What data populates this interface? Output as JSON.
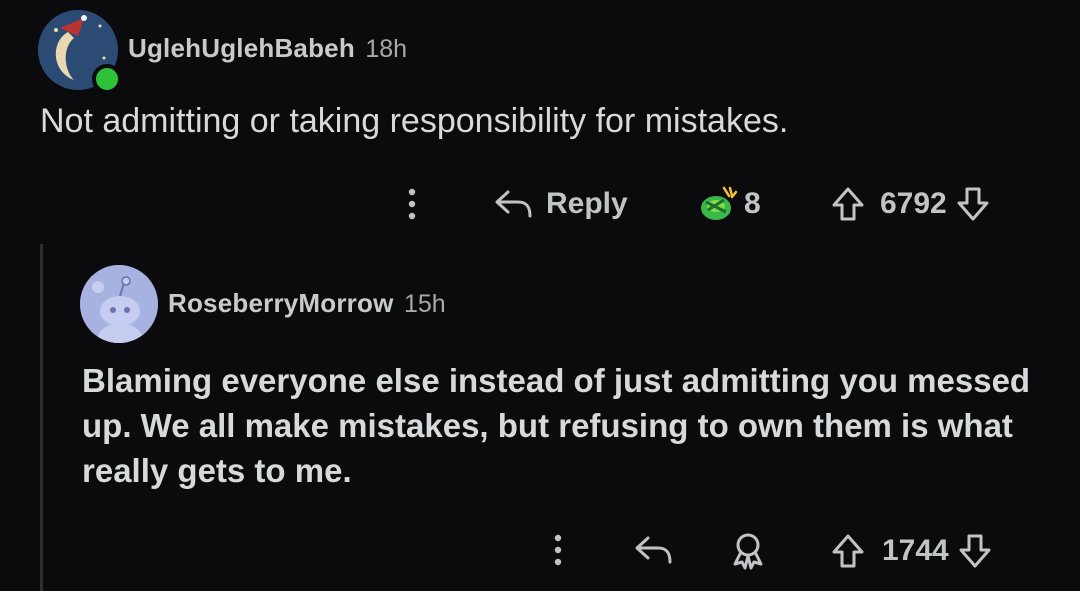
{
  "comment": {
    "username": "UglehUglehBabeh",
    "time": "18h",
    "body": "Not admitting or taking responsibility for mistakes.",
    "reply_label": "Reply",
    "award_count": "8",
    "score": "6792"
  },
  "reply": {
    "username": "RoseberryMorrow",
    "time": "15h",
    "body": "Blaming everyone else instead of just admitting you messed up. We all make mistakes, but refusing to own them is what really gets to me.",
    "score": "1744"
  },
  "colors": {
    "background": "#0b0b0d",
    "text": "#d7dadc",
    "muted": "#a6aaad",
    "online": "#2ec13a",
    "thread_line": "#2f3033",
    "reply_avatar": "#a7b2e0"
  },
  "icons": [
    "more-icon",
    "reply-icon",
    "award-icon",
    "upvote-icon",
    "downvote-icon"
  ]
}
